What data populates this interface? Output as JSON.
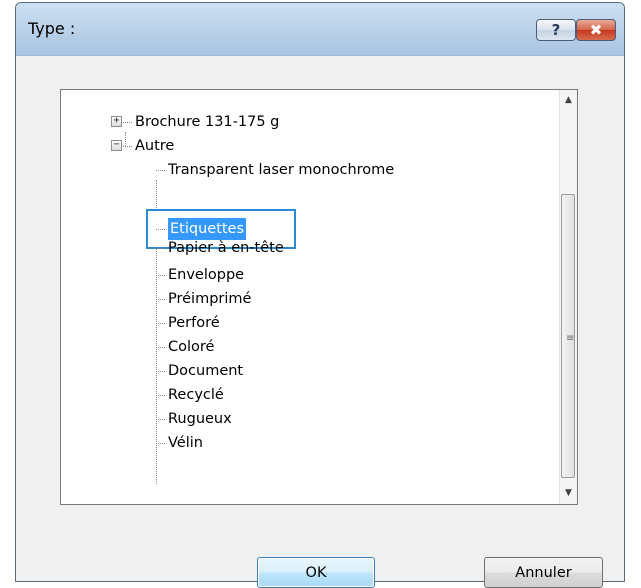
{
  "dialog": {
    "title": "Type :",
    "help_glyph": "?",
    "close_glyph": "✖"
  },
  "tree": {
    "nodes": [
      {
        "label": "Brochure 131-175 g",
        "expander": "+"
      },
      {
        "label": "Autre",
        "expander": "−"
      },
      {
        "label": "Transparent laser monochrome"
      },
      {
        "label": "Etiquettes",
        "selected": true
      },
      {
        "label": "Papier à en-tête"
      },
      {
        "label": "Enveloppe"
      },
      {
        "label": "Préimprimé"
      },
      {
        "label": "Perforé"
      },
      {
        "label": "Coloré"
      },
      {
        "label": "Document"
      },
      {
        "label": "Recyclé"
      },
      {
        "label": "Rugueux"
      },
      {
        "label": "Vélin"
      }
    ]
  },
  "scrollbar": {
    "up_glyph": "▲",
    "down_glyph": "▼",
    "grip_glyph": "≡"
  },
  "buttons": {
    "ok_label": "OK",
    "cancel_label": "Annuler"
  },
  "colors": {
    "selection": "#3399ff",
    "selection_border": "#2b8ad2"
  }
}
